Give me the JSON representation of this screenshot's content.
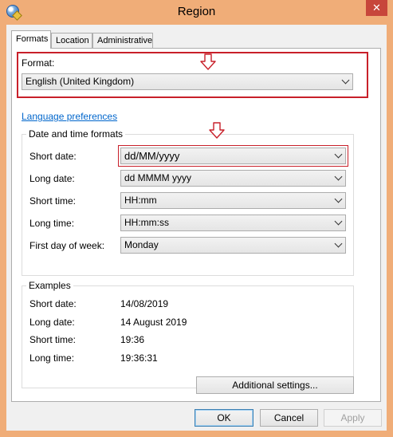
{
  "window": {
    "title": "Region",
    "close_glyph": "✕"
  },
  "tabs": [
    {
      "label": "Formats",
      "active": true
    },
    {
      "label": "Location",
      "active": false
    },
    {
      "label": "Administrative",
      "active": false
    }
  ],
  "format": {
    "label": "Format:",
    "value": "English (United Kingdom)"
  },
  "language_link": "Language preferences",
  "date_time": {
    "legend": "Date and time formats",
    "short_date": {
      "label": "Short date:",
      "value": "dd/MM/yyyy"
    },
    "long_date": {
      "label": "Long date:",
      "value": "dd MMMM yyyy"
    },
    "short_time": {
      "label": "Short time:",
      "value": "HH:mm"
    },
    "long_time": {
      "label": "Long time:",
      "value": "HH:mm:ss"
    },
    "first_day": {
      "label": "First day of week:",
      "value": "Monday"
    }
  },
  "examples": {
    "legend": "Examples",
    "short_date": {
      "label": "Short date:",
      "value": "14/08/2019"
    },
    "long_date": {
      "label": "Long date:",
      "value": "14 August 2019"
    },
    "short_time": {
      "label": "Short time:",
      "value": "19:36"
    },
    "long_time": {
      "label": "Long time:",
      "value": "19:36:31"
    }
  },
  "buttons": {
    "additional": "Additional settings...",
    "ok": "OK",
    "cancel": "Cancel",
    "apply": "Apply"
  },
  "colors": {
    "title_bar": "#f0ad78",
    "annotation": "#c8202a",
    "link": "#0066cc"
  },
  "icons": [
    "globe-clock-icon",
    "close-icon",
    "chevron-down-icon",
    "annotation-arrow-icon"
  ]
}
